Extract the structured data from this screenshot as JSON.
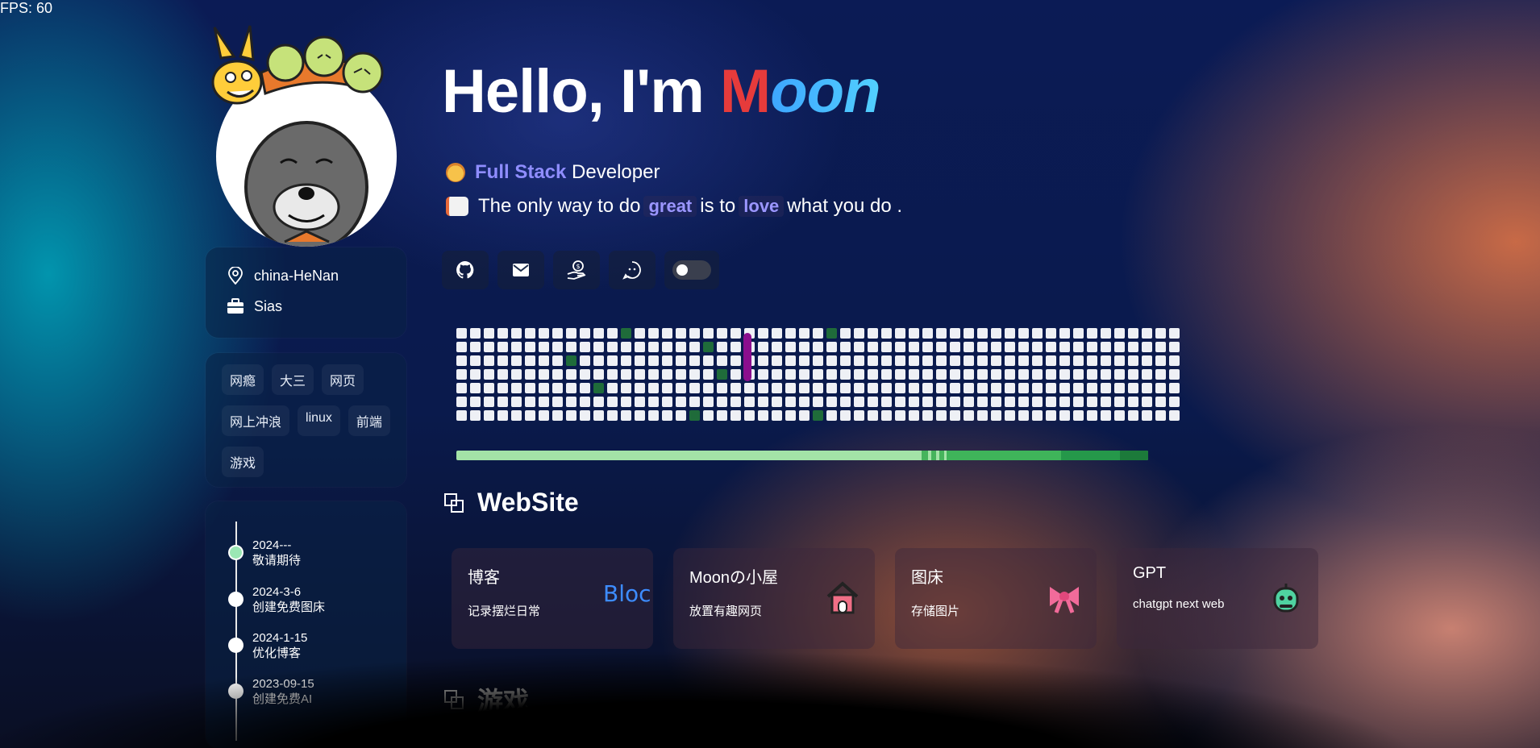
{
  "fps": "FPS: 60",
  "profile": {
    "location": "china-HeNan",
    "org": "Sias",
    "tags": [
      "网瘾",
      "大三",
      "网页",
      "网上冲浪",
      "linux",
      "前端",
      "游戏"
    ]
  },
  "timeline": [
    {
      "date": "2024---",
      "text": "敬请期待",
      "active": true
    },
    {
      "date": "2024-3-6",
      "text": "创建免费图床",
      "active": false
    },
    {
      "date": "2024-1-15",
      "text": "优化博客",
      "active": false
    },
    {
      "date": "2023-09-15",
      "text": "创建免费AI",
      "active": false
    }
  ],
  "hero": {
    "hello": "Hello, I'm ",
    "name_first": "M",
    "name_rest": "oon",
    "role_highlight": "Full Stack",
    "role_rest": " Developer",
    "quote_1": "The only way to do",
    "quote_great": "great",
    "quote_2": "is to",
    "quote_love": "love",
    "quote_3": "what you do ."
  },
  "social": [
    "github-icon",
    "mail-icon",
    "donate-icon",
    "chat-icon",
    "theme-toggle"
  ],
  "sections": {
    "website": "WebSite",
    "games": "游戏"
  },
  "sites": [
    {
      "title": "博客",
      "desc": "记录摆烂日常",
      "icon": "blog-logo"
    },
    {
      "title": "Moonの小屋",
      "desc": "放置有趣网页",
      "icon": "house-icon"
    },
    {
      "title": "图床",
      "desc": "存储图片",
      "icon": "bow-icon"
    },
    {
      "title": "GPT",
      "desc": "chatgpt next web",
      "icon": "robot-icon"
    }
  ],
  "colors": {
    "accent_purple": "#8f8dff",
    "name_red": "#e63b3b",
    "name_blue": "#3da5ff",
    "grid_green": "#1f6b3a"
  },
  "blog_logo_text": "Bloc"
}
